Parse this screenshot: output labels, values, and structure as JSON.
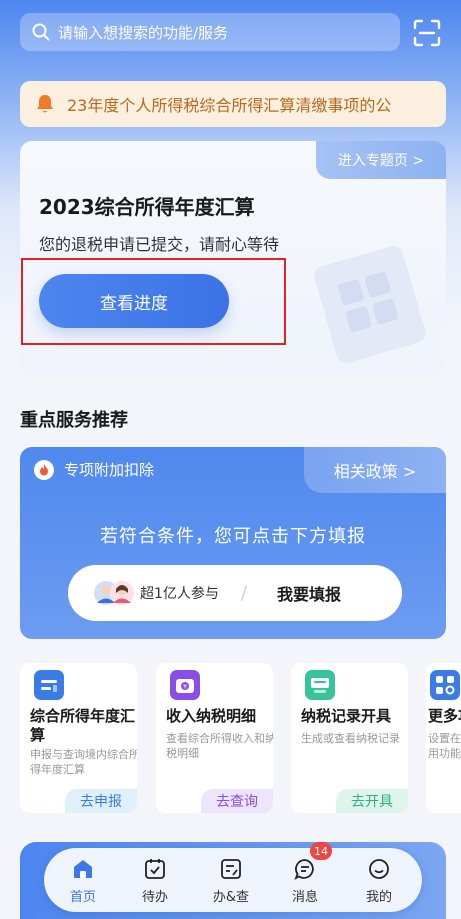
{
  "search": {
    "placeholder": "请输入想搜索的功能/服务"
  },
  "notice": {
    "text": "23年度个人所得税综合所得汇算清缴事项的公"
  },
  "hero": {
    "topic_link": "进入专题页 >",
    "title": "2023综合所得年度汇算",
    "subtitle": "您的退税申请已提交，请耐心等待",
    "button": "查看进度"
  },
  "section": {
    "title": "重点服务推荐"
  },
  "promo": {
    "tag": "专项附加扣除",
    "policy_link": "相关政策 >",
    "headline": "若符合条件，您可点击下方填报",
    "participants": "超1亿人参与",
    "separator": "/",
    "cta": "我要填报"
  },
  "cards": [
    {
      "name": "综合所得年度汇算",
      "desc": "申报与查询境内综合所得年度汇算",
      "action": "去申报",
      "icon": "tax-report-icon"
    },
    {
      "name": "收入纳税明细",
      "desc": "查看综合所得收入和纳税明细",
      "action": "去查询",
      "icon": "income-detail-icon"
    },
    {
      "name": "纳税记录开具",
      "desc": "生成或查看纳税记录",
      "action": "去开具",
      "icon": "tax-record-icon"
    },
    {
      "name": "更多功",
      "desc": "设置在用功能",
      "action": "",
      "icon": "more-icon"
    }
  ],
  "tabs": [
    {
      "label": "首页",
      "icon": "home-icon"
    },
    {
      "label": "待办",
      "icon": "todo-icon"
    },
    {
      "label": "办&查",
      "icon": "handle-query-icon"
    },
    {
      "label": "消息",
      "icon": "message-icon"
    },
    {
      "label": "我的",
      "icon": "profile-icon"
    }
  ],
  "message_badge": "14",
  "colors": {
    "primary": "#4d86ef",
    "alert": "#ee4545",
    "highlight_frame": "#e02323",
    "notice_bg": "#fbf0df"
  }
}
